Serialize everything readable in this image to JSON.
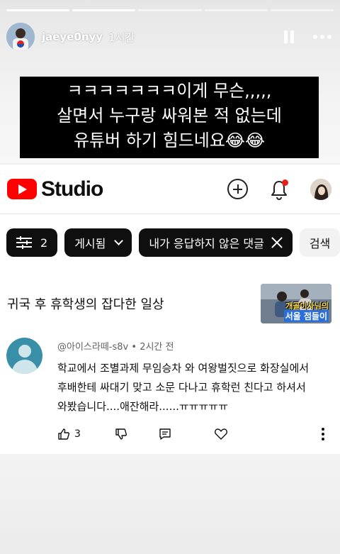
{
  "story": {
    "progress": [
      1,
      1,
      0,
      0,
      0
    ],
    "username": "jaeye0nyy",
    "time": "1시간",
    "caption_lines": [
      "ㅋㅋㅋㅋㅋㅋㅋ이게 무슨,,,,,",
      "살면서 누구랑 싸워본 적 없는데",
      "유튜버 하기 힘드네요😂😂"
    ]
  },
  "studio": {
    "logo_text": "Studio",
    "brand_color": "#ff0000",
    "icons": [
      "plus-circle-icon",
      "bell-icon",
      "avatar"
    ],
    "filters": {
      "count": "2",
      "published": "게시됨",
      "unreplied": "내가 응답하지 않은 댓글",
      "search": "검색"
    },
    "video": {
      "title": "귀국 후 휴학생의 잡다한 일상",
      "thumb_line1": "개골이사님의",
      "thumb_line2": "서울 점들이"
    },
    "comment": {
      "author": "@아이스라떼-s8v",
      "age": "2시간 전",
      "text": "학교에서 조별과제 무임승차 와 여왕벌짓으로 화장실에서 후배한테 싸대기 맞고 소문 다나고 휴학런 친다고 하셔서 와봤습니다....애잔해라......ㅠㅠㅠㅠㅠ",
      "likes": "3"
    }
  }
}
